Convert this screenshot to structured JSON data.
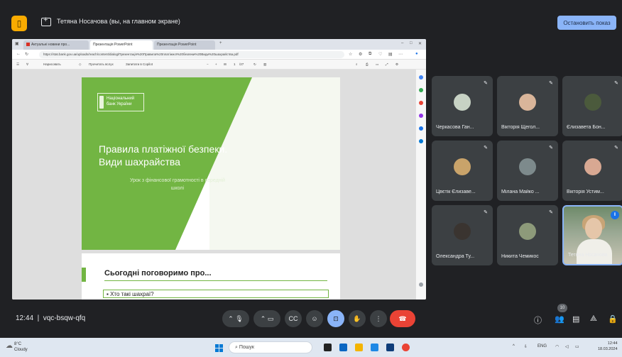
{
  "meet": {
    "presenter_title": "Тетяна Носачова (вы, на главном экране)",
    "stop_button": "Остановить показ",
    "time": "12:44",
    "meeting_code": "vqc-bsqw-qfq",
    "people_count": "10"
  },
  "browser": {
    "tabs": [
      {
        "label": "Актуальні новини про..."
      },
      {
        "label": "Презентація PowerPoint"
      },
      {
        "label": "Презентація PowerPoint"
      }
    ],
    "url": "https://stat.bank.gov.ua/uploads/reach/content/dialog/Презентація%20Правила%20платіжної%20безпеки%20Види%20шахрайства.pdf",
    "pdf_toolbar": {
      "draw": "Нарисовать",
      "read_aloud": "Прочитать вслух",
      "ask_copilot": "Запитати в Copilot",
      "page": "1",
      "total": "/27"
    }
  },
  "slide": {
    "logo_text": "Національний банк України",
    "title": "Правила платіжної безпеки. Види шахрайства",
    "subtitle": "Урок з фінансової грамотності в середній школі"
  },
  "slide2": {
    "title": "Сьогодні поговоримо про...",
    "item": "Хто такі шахраї?"
  },
  "participants": [
    {
      "name": "Черкасова Ган...",
      "avatar_color": "#c7d2c4"
    },
    {
      "name": "Вікторія Щегол...",
      "avatar_color": "#d9b59a"
    },
    {
      "name": "Єлизавета Бон...",
      "avatar_color": "#4b5a3c"
    },
    {
      "name": "Цвєтік Єлизаве...",
      "avatar_color": "#c9a36a"
    },
    {
      "name": "Мілана Майко ...",
      "avatar_color": "#7d8a8c"
    },
    {
      "name": "Вікторія Устим...",
      "avatar_color": "#d8a892"
    },
    {
      "name": "Олександра Ту...",
      "avatar_color": "#3a3430"
    },
    {
      "name": "Никита Чемикос",
      "avatar_color": "#8d9a7a"
    },
    {
      "name": "Тетяна Носачова",
      "avatar_color": "#e5c6a9"
    }
  ],
  "taskbar": {
    "temperature": "8°C",
    "weather": "Cloudy",
    "search_placeholder": "Пошук",
    "lang": "ENG",
    "clock_time": "12:44",
    "clock_date": "18.03.2024"
  },
  "colors": {
    "meet_bg": "#202124",
    "tile_bg": "#3c4043",
    "accent_blue": "#8ab4f8",
    "end_call_red": "#ea4335",
    "nbu_green": "#72b543"
  }
}
